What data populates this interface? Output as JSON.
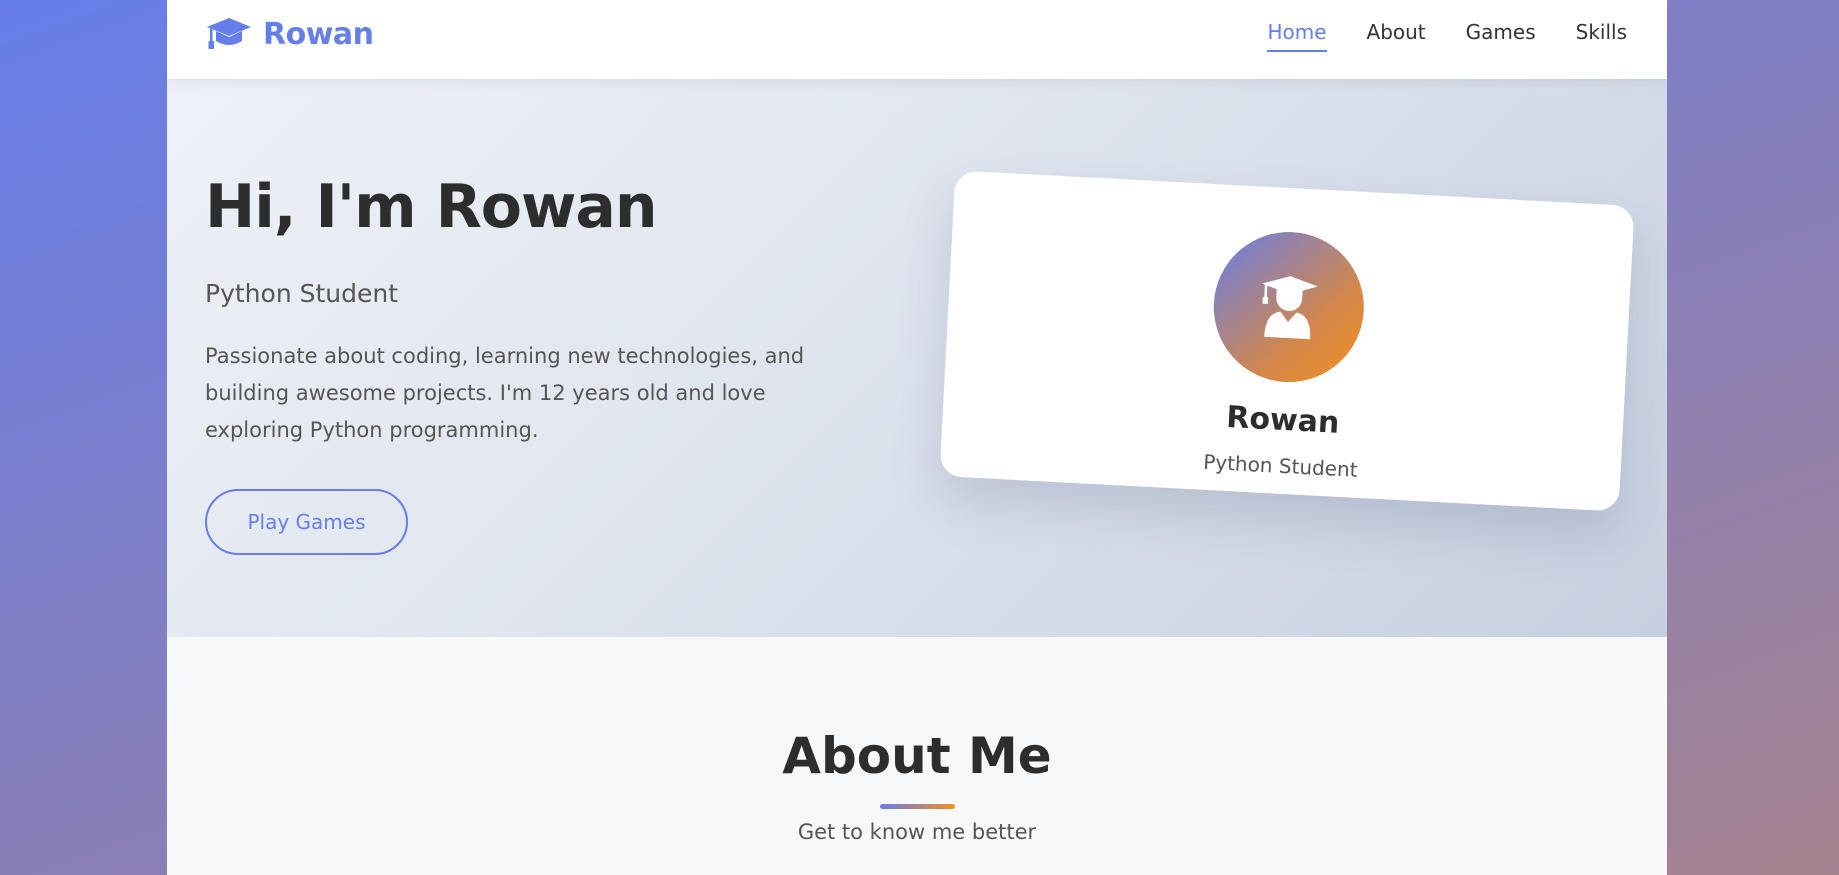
{
  "nav": {
    "brand": "Rowan",
    "brand_icon": "graduation-cap-icon",
    "links": [
      {
        "label": "Home",
        "active": true
      },
      {
        "label": "About",
        "active": false
      },
      {
        "label": "Games",
        "active": false
      },
      {
        "label": "Skills",
        "active": false
      }
    ]
  },
  "hero": {
    "title": "Hi, I'm Rowan",
    "subtitle": "Python Student",
    "description": "Passionate about coding, learning new technologies, and building awesome projects. I'm 12 years old and love exploring Python programming.",
    "button_label": "Play Games"
  },
  "profile_card": {
    "avatar_icon": "user-graduate-icon",
    "name": "Rowan",
    "role": "Python Student"
  },
  "about": {
    "title": "About Me",
    "subtitle": "Get to know me better"
  },
  "colors": {
    "accent": "#667eea",
    "accent_secondary": "#f09020",
    "text_dark": "#2d2d2d",
    "text_muted": "#555555"
  }
}
